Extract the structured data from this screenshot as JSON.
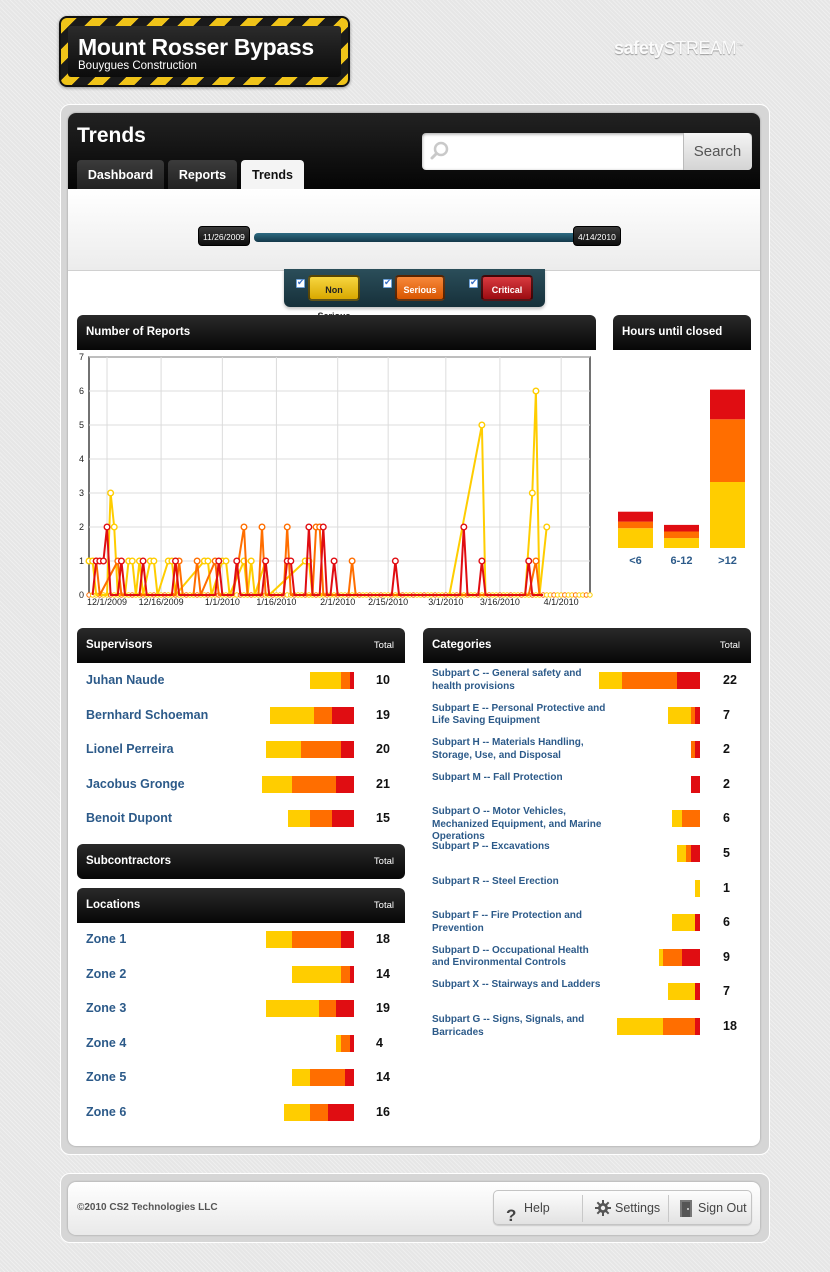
{
  "brand": {
    "title": "Mount Rosser Bypass",
    "subtitle": "Bouygues Construction"
  },
  "logo": {
    "bold": "safety",
    "light": "STREAM",
    "tm": "™"
  },
  "page_title": "Trends",
  "tabs": [
    {
      "label": "Dashboard",
      "active": false
    },
    {
      "label": "Reports",
      "active": false
    },
    {
      "label": "Trends",
      "active": true
    }
  ],
  "search": {
    "value": "",
    "placeholder": "",
    "button": "Search"
  },
  "timeline": {
    "start": "11/26/2009",
    "end": "4/14/2010"
  },
  "filters": [
    {
      "label": "Non Serious",
      "checked": true,
      "color": "#f4c20e"
    },
    {
      "label": "Serious",
      "checked": true,
      "color": "#f06d1c"
    },
    {
      "label": "Critical",
      "checked": true,
      "color": "#c9141d"
    }
  ],
  "colors": {
    "non_serious": "#ffcd00",
    "serious": "#ff6e00",
    "critical": "#e00d12"
  },
  "reports_panel": {
    "title": "Number of Reports"
  },
  "hours_panel": {
    "title": "Hours until closed"
  },
  "chart_data": [
    {
      "type": "line",
      "title": "Number of Reports",
      "x_tick_labels": [
        "12/1/2009",
        "12/16/2009",
        "1/1/2010",
        "1/16/2010",
        "2/1/2010",
        "2/15/2010",
        "3/1/2010",
        "3/16/2010",
        "4/1/2010"
      ],
      "x_range": [
        "11/26/2009",
        "4/14/2010"
      ],
      "ylim": [
        0,
        7
      ],
      "y_ticks": [
        0,
        1,
        2,
        3,
        4,
        5,
        6,
        7
      ],
      "grid": true,
      "series": [
        {
          "color": "#ffcd00",
          "points": [
            [
              0,
              1
            ],
            [
              1,
              1
            ],
            [
              2,
              0
            ],
            [
              5,
              0
            ],
            [
              6,
              3
            ],
            [
              7,
              2
            ],
            [
              8,
              0
            ],
            [
              10,
              0
            ],
            [
              11,
              1
            ],
            [
              12,
              1
            ],
            [
              13,
              0
            ],
            [
              14,
              1
            ],
            [
              15,
              0
            ],
            [
              17,
              1
            ],
            [
              18,
              1
            ],
            [
              19,
              0
            ],
            [
              22,
              1
            ],
            [
              23,
              1
            ],
            [
              24,
              0
            ],
            [
              32,
              1
            ],
            [
              33,
              1
            ],
            [
              34,
              0
            ],
            [
              37,
              1
            ],
            [
              38,
              1
            ],
            [
              39,
              0
            ],
            [
              43,
              1
            ],
            [
              44,
              0
            ],
            [
              45,
              1
            ],
            [
              46,
              0
            ],
            [
              49,
              1
            ],
            [
              50,
              0
            ],
            [
              60,
              1
            ],
            [
              61,
              1
            ],
            [
              62,
              0
            ],
            [
              66,
              0
            ],
            [
              73,
              0
            ],
            [
              76,
              0
            ],
            [
              100,
              0
            ],
            [
              109,
              5
            ],
            [
              110,
              0
            ],
            [
              121,
              0
            ],
            [
              123,
              3
            ],
            [
              124,
              6
            ],
            [
              125,
              0
            ],
            [
              127,
              2
            ]
          ]
        },
        {
          "color": "#ff6e00",
          "points": [
            [
              2,
              1
            ],
            [
              3,
              0
            ],
            [
              8,
              1
            ],
            [
              9,
              0
            ],
            [
              13,
              0
            ],
            [
              17,
              0
            ],
            [
              24,
              0
            ],
            [
              25,
              1
            ],
            [
              26,
              0
            ],
            [
              29,
              0
            ],
            [
              30,
              1
            ],
            [
              31,
              0
            ],
            [
              35,
              1
            ],
            [
              36,
              0
            ],
            [
              40,
              0
            ],
            [
              43,
              2
            ],
            [
              44,
              0
            ],
            [
              47,
              0
            ],
            [
              48,
              2
            ],
            [
              49,
              0
            ],
            [
              54,
              0
            ],
            [
              55,
              2
            ],
            [
              56,
              0
            ],
            [
              57,
              0
            ],
            [
              60,
              0
            ],
            [
              61,
              0
            ],
            [
              62,
              0
            ],
            [
              63,
              2
            ],
            [
              64,
              2
            ],
            [
              65,
              0
            ],
            [
              72,
              0
            ],
            [
              73,
              1
            ],
            [
              74,
              0
            ],
            [
              104,
              0
            ],
            [
              122,
              0
            ],
            [
              124,
              1
            ],
            [
              125,
              0
            ],
            [
              126,
              0
            ]
          ]
        },
        {
          "color": "#e00d12",
          "points": [
            [
              1,
              0
            ],
            [
              2,
              1
            ],
            [
              3,
              1
            ],
            [
              4,
              1
            ],
            [
              5,
              2
            ],
            [
              6,
              0
            ],
            [
              8,
              0
            ],
            [
              9,
              1
            ],
            [
              10,
              0
            ],
            [
              14,
              0
            ],
            [
              15,
              1
            ],
            [
              16,
              0
            ],
            [
              23,
              0
            ],
            [
              24,
              1
            ],
            [
              25,
              0
            ],
            [
              35,
              0
            ],
            [
              36,
              1
            ],
            [
              37,
              0
            ],
            [
              40,
              0
            ],
            [
              41,
              1
            ],
            [
              42,
              0
            ],
            [
              48,
              0
            ],
            [
              49,
              1
            ],
            [
              50,
              0
            ],
            [
              54,
              0
            ],
            [
              55,
              1
            ],
            [
              56,
              1
            ],
            [
              57,
              0
            ],
            [
              60,
              0
            ],
            [
              61,
              2
            ],
            [
              62,
              0
            ],
            [
              64,
              0
            ],
            [
              65,
              2
            ],
            [
              66,
              0
            ],
            [
              67,
              0
            ],
            [
              68,
              1
            ],
            [
              69,
              0
            ],
            [
              84,
              0
            ],
            [
              85,
              1
            ],
            [
              86,
              0
            ],
            [
              103,
              0
            ],
            [
              104,
              2
            ],
            [
              105,
              0
            ],
            [
              108,
              0
            ],
            [
              109,
              1
            ],
            [
              110,
              0
            ],
            [
              121,
              0
            ],
            [
              122,
              1
            ],
            [
              123,
              0
            ],
            [
              126,
              0
            ]
          ]
        }
      ]
    },
    {
      "type": "bar",
      "title": "Hours until closed",
      "categories": [
        "<6",
        "6-12",
        ">12"
      ],
      "stacked": true,
      "y_max": 5,
      "series": [
        {
          "color": "#ffcd00",
          "values": [
            0.6,
            0.3,
            2.0
          ]
        },
        {
          "color": "#ff6e00",
          "values": [
            0.2,
            0.2,
            1.9
          ]
        },
        {
          "color": "#e00d12",
          "values": [
            0.3,
            0.2,
            0.9
          ]
        }
      ]
    }
  ],
  "supervisors": {
    "title": "Supervisors",
    "total_label": "Total",
    "rows": [
      {
        "name": "Juhan Naude",
        "total": "10",
        "parts": [
          7,
          2,
          1
        ]
      },
      {
        "name": "Bernhard Schoeman",
        "total": "19",
        "parts": [
          10,
          4,
          5
        ]
      },
      {
        "name": "Lionel Perreira",
        "total": "20",
        "parts": [
          8,
          9,
          3
        ]
      },
      {
        "name": "Jacobus Gronge",
        "total": "21",
        "parts": [
          7,
          10,
          4
        ]
      },
      {
        "name": "Benoit Dupont",
        "total": "15",
        "parts": [
          5,
          5,
          5
        ]
      }
    ]
  },
  "subcontractors": {
    "title": "Subcontractors",
    "total_label": "Total"
  },
  "locations": {
    "title": "Locations",
    "total_label": "Total",
    "rows": [
      {
        "name": "Zone 1",
        "total": "18",
        "parts": [
          6,
          11,
          3
        ]
      },
      {
        "name": "Zone 2",
        "total": "14",
        "parts": [
          11,
          2,
          1
        ]
      },
      {
        "name": "Zone 3",
        "total": "19",
        "parts": [
          12,
          4,
          4
        ]
      },
      {
        "name": "Zone 4",
        "total": "4",
        "parts": [
          1,
          2,
          1
        ]
      },
      {
        "name": "Zone 5",
        "total": "14",
        "parts": [
          4,
          8,
          2
        ]
      },
      {
        "name": "Zone 6",
        "total": "16",
        "parts": [
          6,
          4,
          6
        ]
      }
    ]
  },
  "categories": {
    "title": "Categories",
    "total_label": "Total",
    "rows": [
      {
        "name": "Subpart C -- General safety and health provisions",
        "total": "22",
        "parts": [
          5,
          12,
          5
        ]
      },
      {
        "name": "Subpart E -- Personal Protective and Life Saving Equipment",
        "total": "7",
        "parts": [
          5,
          1,
          1
        ]
      },
      {
        "name": "Subpart H -- Materials Handling, Storage, Use, and Disposal",
        "total": "2",
        "parts": [
          0,
          1,
          1
        ]
      },
      {
        "name": "Subpart M -- Fall Protection",
        "total": "2",
        "parts": [
          0,
          0,
          2
        ]
      },
      {
        "name": "Subpart O -- Motor Vehicles, Mechanized Equipment, and Marine Operations",
        "total": "6",
        "parts": [
          2,
          4,
          0
        ]
      },
      {
        "name": "Subpart P -- Excavations",
        "total": "5",
        "parts": [
          2,
          1,
          2
        ]
      },
      {
        "name": "Subpart R -- Steel Erection",
        "total": "1",
        "parts": [
          1,
          0,
          0
        ]
      },
      {
        "name": "Subpart F -- Fire Protection and Prevention",
        "total": "6",
        "parts": [
          5,
          0,
          1
        ]
      },
      {
        "name": "Subpart D -- Occupational Health and Environmental Controls",
        "total": "9",
        "parts": [
          1,
          4,
          4
        ]
      },
      {
        "name": "Subpart X -- Stairways and Ladders",
        "total": "7",
        "parts": [
          6,
          0,
          1
        ]
      },
      {
        "name": "Subpart G -- Signs, Signals, and Barricades",
        "total": "18",
        "parts": [
          10,
          7,
          1
        ]
      }
    ]
  },
  "footer": {
    "copyright": "©2010 CS2 Technologies LLC",
    "help": "Help",
    "settings": "Settings",
    "signout": "Sign Out"
  }
}
